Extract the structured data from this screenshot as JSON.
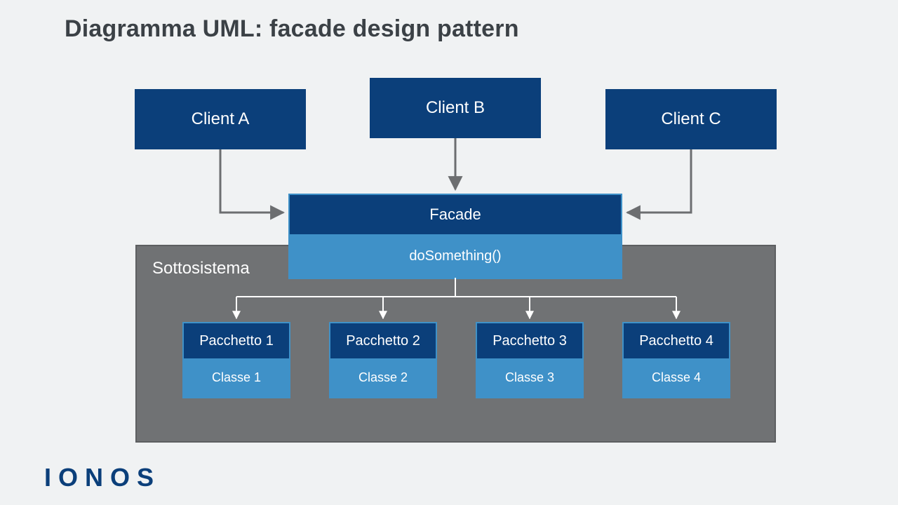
{
  "title": "Diagramma UML: facade design pattern",
  "clients": {
    "a": "Client A",
    "b": "Client B",
    "c": "Client C"
  },
  "subsystem_label": "Sottosistema",
  "facade": {
    "name": "Facade",
    "method": "doSomething()"
  },
  "packages": [
    {
      "name": "Pacchetto 1",
      "class": "Classe 1"
    },
    {
      "name": "Pacchetto 2",
      "class": "Classe 2"
    },
    {
      "name": "Pacchetto 3",
      "class": "Classe 3"
    },
    {
      "name": "Pacchetto 4",
      "class": "Classe 4"
    }
  ],
  "logo": "IONOS"
}
